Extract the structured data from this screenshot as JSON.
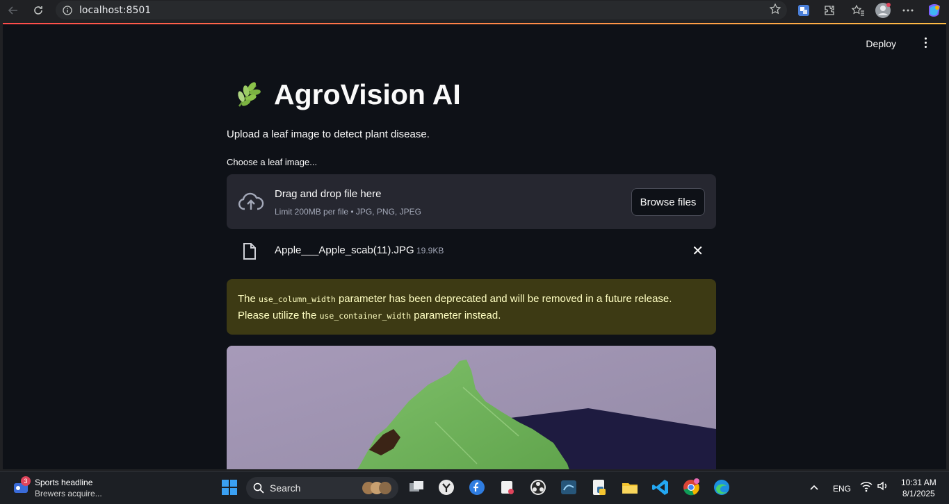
{
  "browser": {
    "url": "localhost:8501"
  },
  "app": {
    "deploy_label": "Deploy",
    "title": "AgroVision AI",
    "subtitle": "Upload a leaf image to detect plant disease.",
    "uploader_label": "Choose a leaf image...",
    "dropzone": {
      "title": "Drag and drop file here",
      "limit": "Limit 200MB per file • JPG, PNG, JPEG",
      "browse_label": "Browse files"
    },
    "file": {
      "name": "Apple___Apple_scab(11).JPG",
      "size": "19.9KB"
    },
    "warning": {
      "part1": "The ",
      "code1": "use_column_width",
      "part2": " parameter has been deprecated and will be removed in a future release. Please utilize the ",
      "code2": "use_container_width",
      "part3": " parameter instead."
    }
  },
  "taskbar": {
    "news_count": "3",
    "news_title": "Sports headline",
    "news_sub": "Brewers acquire...",
    "search_placeholder": "Search",
    "language": "ENG",
    "time": "10:31 AM",
    "date": "8/1/2025"
  },
  "colors": {
    "app_bg": "#0e1117",
    "panel_bg": "#262730",
    "warning_bg": "#3d3a14",
    "warning_text": "#ffffc2"
  }
}
